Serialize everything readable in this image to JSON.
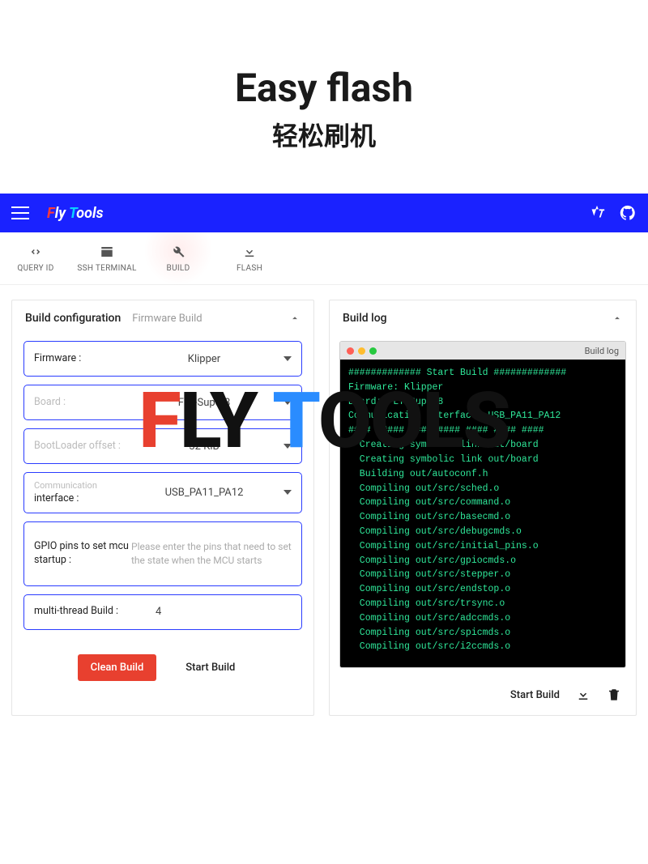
{
  "hero": {
    "title": "Easy flash",
    "subtitle": "轻松刷机"
  },
  "appbar": {
    "brand_f": "F",
    "brand_ly": "ly ",
    "brand_t": "T",
    "brand_ools": "ools"
  },
  "tabs": [
    {
      "label": "QUERY ID"
    },
    {
      "label": "SSH TERMINAL"
    },
    {
      "label": "BUILD"
    },
    {
      "label": "FLASH"
    }
  ],
  "config": {
    "title": "Build configuration",
    "subtitle": "Firmware Build",
    "fields": {
      "firmware_label": "Firmware :",
      "firmware_value": "Klipper",
      "board_label": "Board :",
      "board_value": "FLY-Super8",
      "bootloader_label": "BootLoader offset :",
      "bootloader_value": "32 KiB",
      "comm_label_small": "Communication",
      "comm_label": "interface :",
      "comm_value": "USB_PA11_PA12",
      "gpio_label": "GPIO pins to set mcu startup :",
      "gpio_placeholder": "Please enter the pins that need to set the state when the MCU starts",
      "threads_label": "multi-thread Build :",
      "threads_value": "4"
    },
    "actions": {
      "clean": "Clean Build",
      "start": "Start Build"
    }
  },
  "log": {
    "title": "Build log",
    "window_title": "Build log",
    "lines": [
      "############# Start Build #############",
      "Firmware: Klipper",
      "Board: FLY-Super8",
      "Communication interface: USB_PA11_PA12",
      "#### ##### #### #### #### #### ####",
      "  Creating symbolic link out/board",
      "  Creating symbolic link out/board",
      "  Building out/autoconf.h",
      "  Compiling out/src/sched.o",
      "  Compiling out/src/command.o",
      "  Compiling out/src/basecmd.o",
      "  Compiling out/src/debugcmds.o",
      "  Compiling out/src/initial_pins.o",
      "  Compiling out/src/gpiocmds.o",
      "  Compiling out/src/stepper.o",
      "  Compiling out/src/endstop.o",
      "  Compiling out/src/trsync.o",
      "  Compiling out/src/adccmds.o",
      "  Compiling out/src/spicmds.o",
      "  Compiling out/src/i2ccmds.o"
    ],
    "footer_start": "Start Build"
  },
  "watermark": {
    "f": "F",
    "ly": "LY ",
    "t": "T",
    "ools": "OOLS"
  }
}
